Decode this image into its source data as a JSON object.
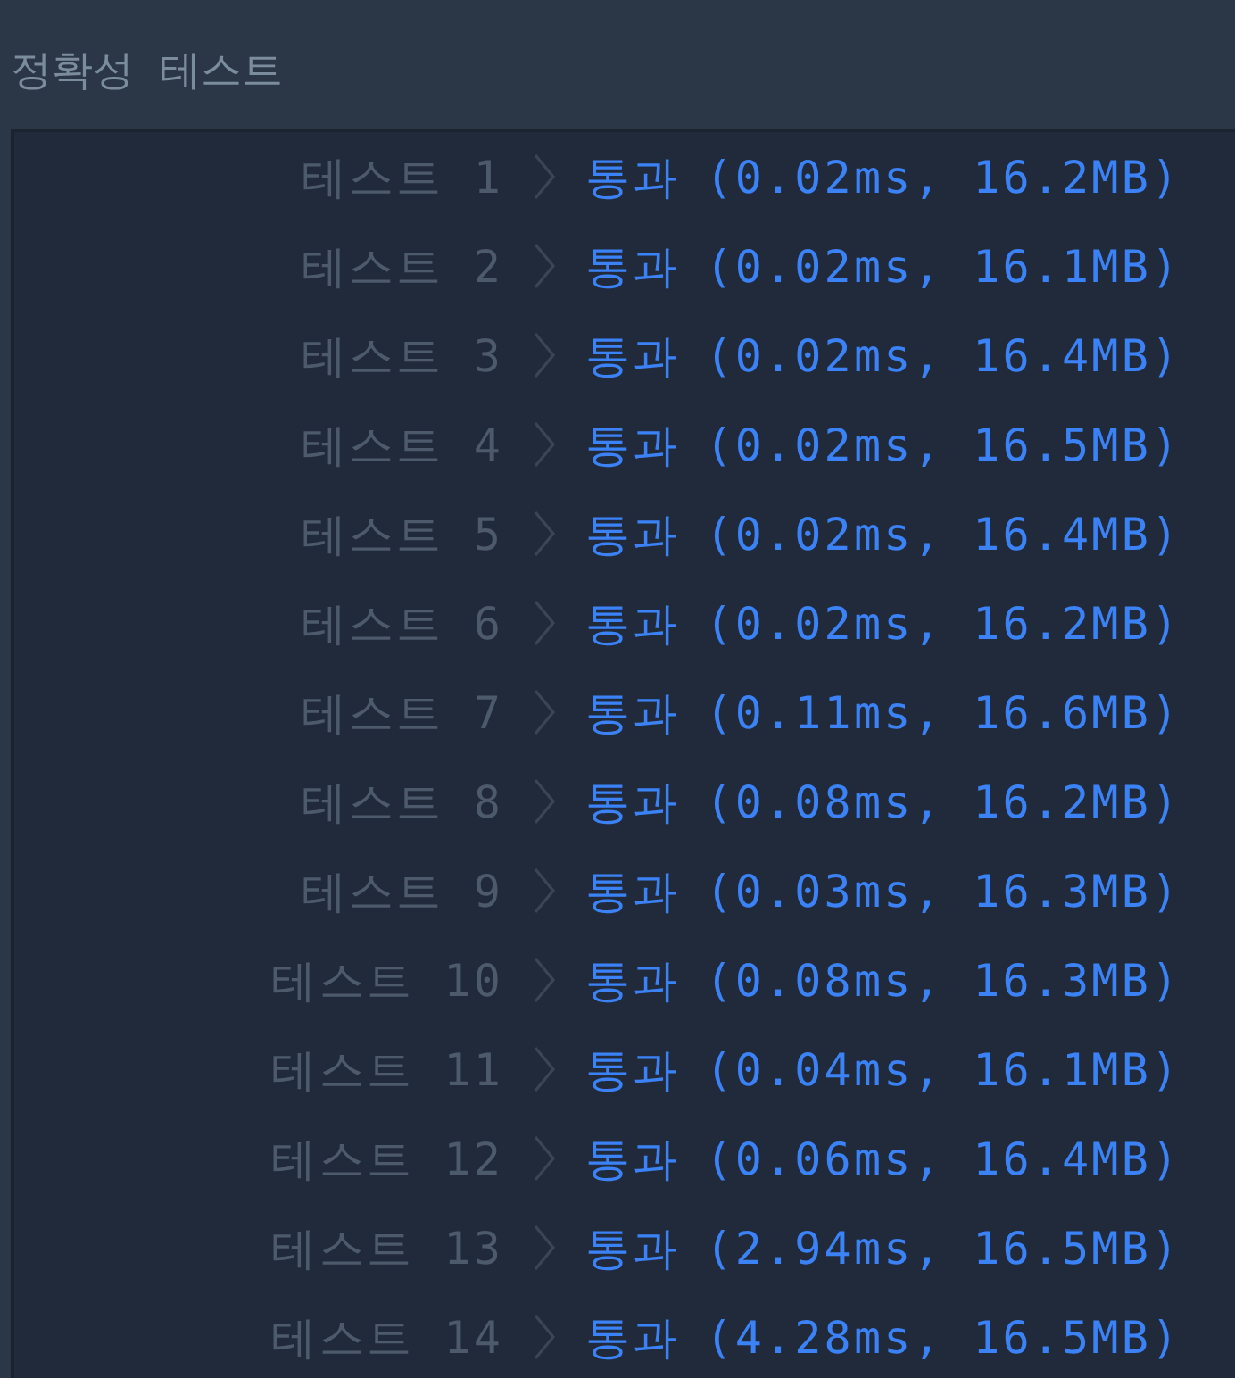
{
  "section_title": "정확성  테스트",
  "results": [
    {
      "label": "테스트 1",
      "status": "통과",
      "detail": "(0.02ms, 16.2MB)",
      "kind": "pass"
    },
    {
      "label": "테스트 2",
      "status": "통과",
      "detail": "(0.02ms, 16.1MB)",
      "kind": "pass"
    },
    {
      "label": "테스트 3",
      "status": "통과",
      "detail": "(0.02ms, 16.4MB)",
      "kind": "pass"
    },
    {
      "label": "테스트 4",
      "status": "통과",
      "detail": "(0.02ms, 16.5MB)",
      "kind": "pass"
    },
    {
      "label": "테스트 5",
      "status": "통과",
      "detail": "(0.02ms, 16.4MB)",
      "kind": "pass"
    },
    {
      "label": "테스트 6",
      "status": "통과",
      "detail": "(0.02ms, 16.2MB)",
      "kind": "pass"
    },
    {
      "label": "테스트 7",
      "status": "통과",
      "detail": "(0.11ms, 16.6MB)",
      "kind": "pass"
    },
    {
      "label": "테스트 8",
      "status": "통과",
      "detail": "(0.08ms, 16.2MB)",
      "kind": "pass"
    },
    {
      "label": "테스트 9",
      "status": "통과",
      "detail": "(0.03ms, 16.3MB)",
      "kind": "pass"
    },
    {
      "label": "테스트 10",
      "status": "통과",
      "detail": "(0.08ms, 16.3MB)",
      "kind": "pass"
    },
    {
      "label": "테스트 11",
      "status": "통과",
      "detail": "(0.04ms, 16.1MB)",
      "kind": "pass"
    },
    {
      "label": "테스트 12",
      "status": "통과",
      "detail": "(0.06ms, 16.4MB)",
      "kind": "pass"
    },
    {
      "label": "테스트 13",
      "status": "통과",
      "detail": "(2.94ms, 16.5MB)",
      "kind": "pass"
    },
    {
      "label": "테스트 14",
      "status": "통과",
      "detail": "(4.28ms, 16.5MB)",
      "kind": "pass"
    }
  ]
}
